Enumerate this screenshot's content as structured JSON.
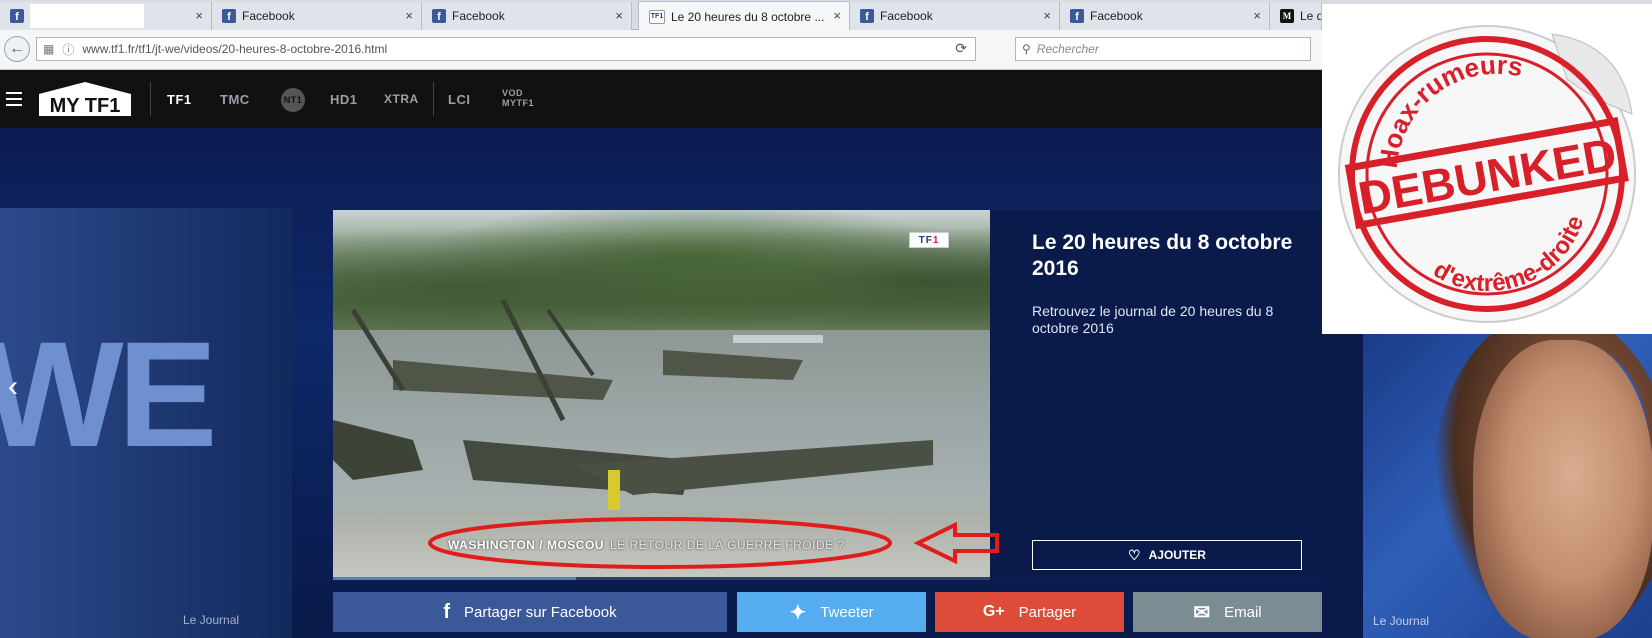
{
  "browser": {
    "tabs": [
      {
        "title": "",
        "close": "×",
        "favicon": "f"
      },
      {
        "title": "Facebook",
        "close": "×",
        "favicon": "f"
      },
      {
        "title": "Facebook",
        "close": "×",
        "favicon": "f"
      },
      {
        "title": "Le 20 heures du 8 octobre ...",
        "close": "×",
        "favicon": "TF1"
      },
      {
        "title": "Facebook",
        "close": "×",
        "favicon": "f"
      },
      {
        "title": "Facebook",
        "close": "×",
        "favicon": "f"
      },
      {
        "title": "Le d",
        "close": "",
        "favicon": "M"
      }
    ],
    "url": "www.tf1.fr/tf1/jt-we/videos/20-heures-8-octobre-2016.html",
    "url_domain": "tf1.fr",
    "search_placeholder": "Rechercher"
  },
  "site": {
    "logo_text": "MY TF1",
    "channels": [
      "TF1",
      "TMC",
      "NT1",
      "HD1",
      "XTRA",
      "LCI",
      "VOD MYTF1"
    ]
  },
  "hero": {
    "left_big_text": "WE",
    "left_caption": "Le Journal",
    "right_caption": "Le Journal",
    "video": {
      "channel_logo_main": "TF",
      "channel_logo_accent": "1",
      "caption_main": "WASHINGTON / MOSCOU",
      "caption_sub": "LE RETOUR DE LA GUERRE FROIDE ?",
      "progress": 0.37
    },
    "info": {
      "title": "Le 20 heures du 8 octobre 2016",
      "description": "Retrouvez le journal de 20 heures du 8 octobre 2016",
      "add_label": "AJOUTER"
    }
  },
  "share": {
    "facebook_label": "Partager sur Facebook",
    "twitter_label": "Tweeter",
    "gplus_label": "Partager",
    "email_label": "Email",
    "colors": {
      "facebook": "#3b5998",
      "twitter": "#55acee",
      "gplus": "#dd4b39",
      "email": "#7c8c93"
    }
  },
  "stamp": {
    "top_text": "Hoax-rumeurs",
    "center_text": "DEBUNKED",
    "bottom_text": "d'extrême-droite",
    "color": "#d8202a"
  },
  "annotation_color": "#e21b1b"
}
